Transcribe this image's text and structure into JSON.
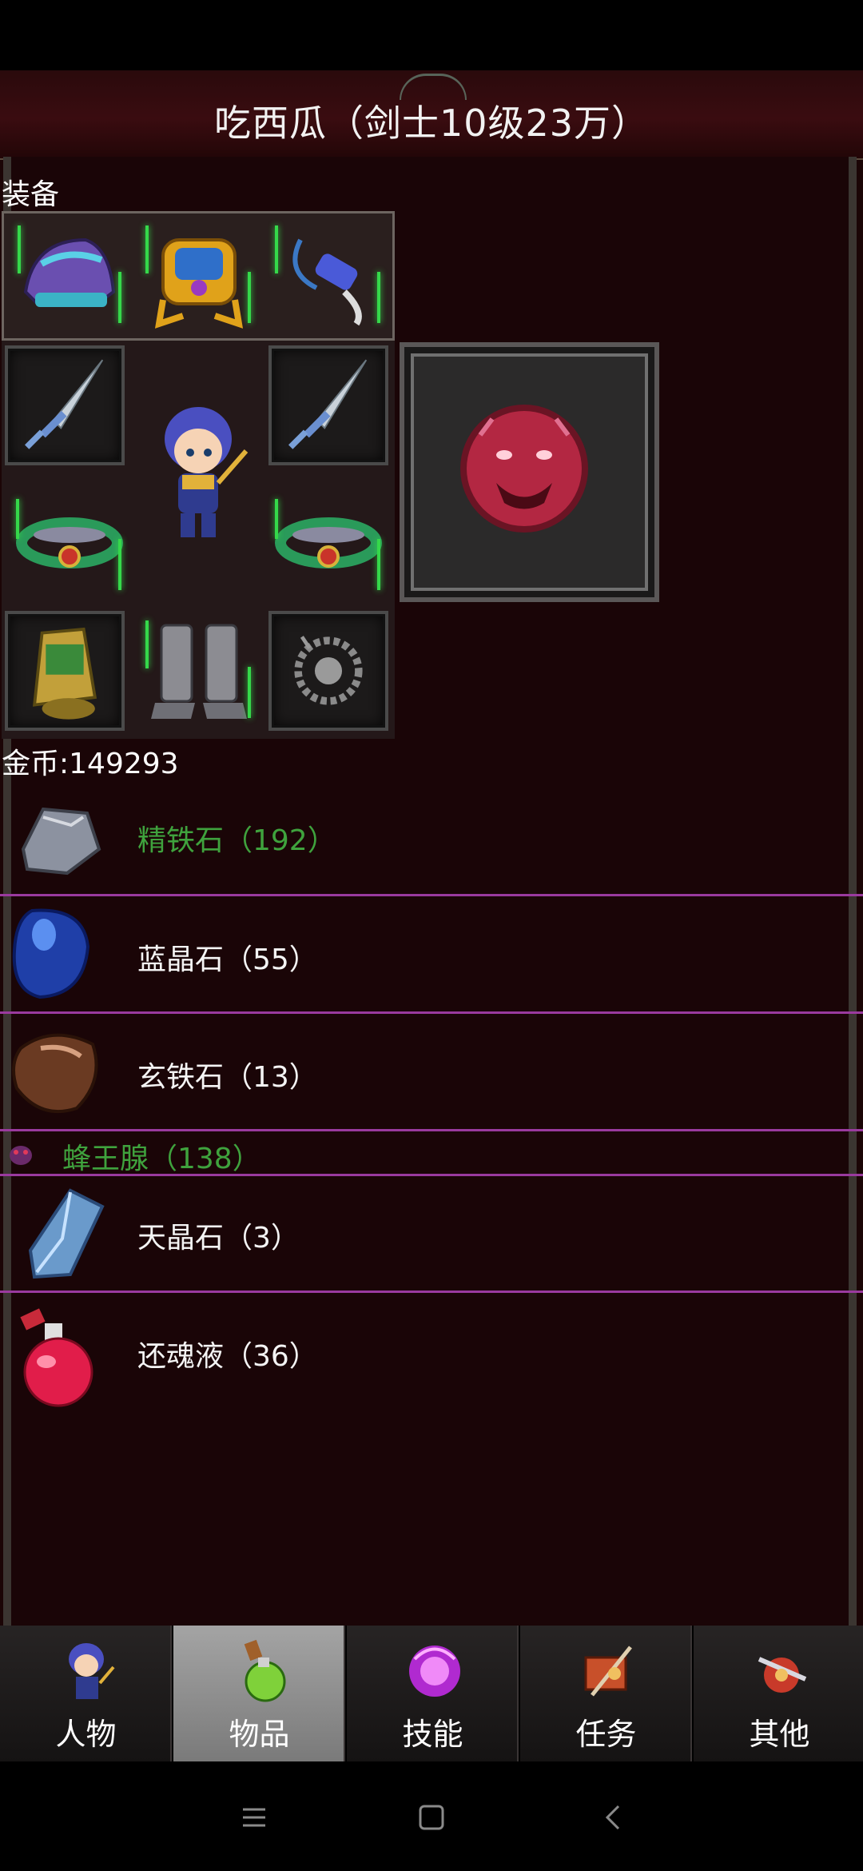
{
  "header": {
    "title": "吃西瓜（剑士10级23万）"
  },
  "equipment": {
    "section_label": "装备"
  },
  "gold": {
    "text": "金币:149293"
  },
  "items": [
    {
      "name": "精铁石（192）",
      "color": "green",
      "icon": "refined-iron-stone-icon"
    },
    {
      "name": "蓝晶石（55）",
      "color": "white",
      "icon": "blue-crystal-icon"
    },
    {
      "name": "玄铁石（13）",
      "color": "white",
      "icon": "dark-iron-stone-icon"
    },
    {
      "name": "蜂王腺（138）",
      "color": "green",
      "icon": "queen-bee-gland-icon"
    },
    {
      "name": "天晶石（3）",
      "color": "white",
      "icon": "sky-crystal-icon"
    },
    {
      "name": "还魂液（36）",
      "color": "white",
      "icon": "revival-potion-icon"
    }
  ],
  "nav": {
    "tabs": [
      {
        "label": "人物",
        "icon": "character-icon"
      },
      {
        "label": "物品",
        "icon": "items-potion-icon",
        "active": true
      },
      {
        "label": "技能",
        "icon": "skills-orb-icon"
      },
      {
        "label": "任务",
        "icon": "quest-icon"
      },
      {
        "label": "其他",
        "icon": "other-icon"
      }
    ]
  },
  "colors": {
    "background": "#1b0506",
    "separator": "#9a3a9e",
    "green_text": "#3fa23d"
  }
}
